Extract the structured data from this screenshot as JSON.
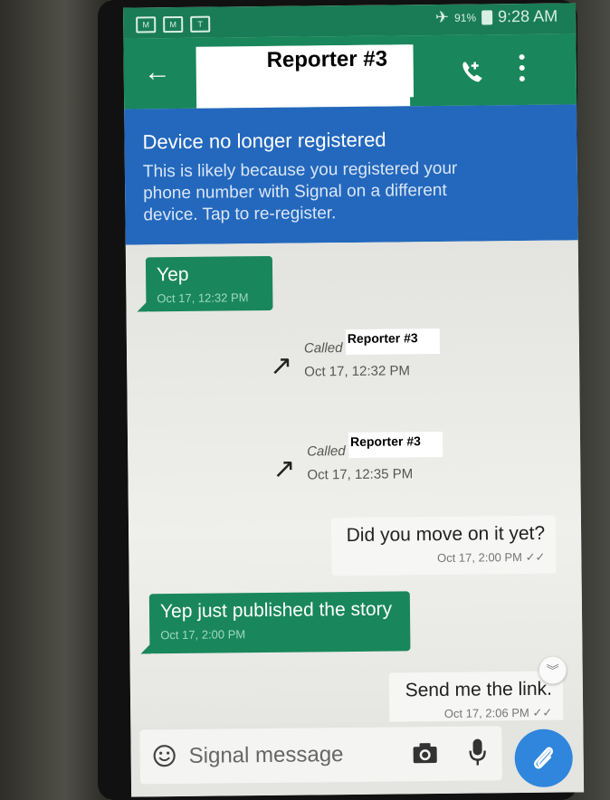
{
  "status_bar": {
    "notif_icons": [
      "M",
      "M",
      "T"
    ],
    "battery": "91%",
    "time": "9:28 AM"
  },
  "header": {
    "contact_name": "Reporter #3"
  },
  "banner": {
    "title": "Device no longer registered",
    "text": "This is likely because you registered your phone number with Signal on a different device. Tap to re-register."
  },
  "messages": [
    {
      "type": "incoming",
      "text": "Yep",
      "timestamp": "Oct 17, 12:32 PM"
    },
    {
      "type": "call",
      "label": "Called",
      "name": "Reporter #3",
      "timestamp": "Oct 17, 12:32 PM"
    },
    {
      "type": "call",
      "label": "Called",
      "name": "Reporter #3",
      "timestamp": "Oct 17, 12:35 PM"
    },
    {
      "type": "outgoing",
      "text": "Did you move on it yet?",
      "timestamp": "Oct 17, 2:00 PM"
    },
    {
      "type": "incoming",
      "text": "Yep just published the story",
      "timestamp": "Oct 17, 2:00 PM"
    },
    {
      "type": "outgoing",
      "text": "Send me the link.",
      "timestamp": "Oct 17, 2:06 PM"
    }
  ],
  "compose": {
    "placeholder": "Signal message"
  },
  "colors": {
    "header_green": "#19875b",
    "banner_blue": "#2368bd",
    "attach_blue": "#2f86dc"
  }
}
